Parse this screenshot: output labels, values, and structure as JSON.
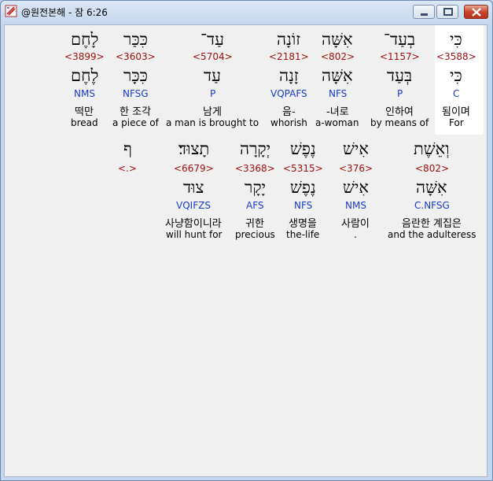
{
  "window": {
    "title": "@원전본해 - 잠 6:26",
    "buttons": {
      "minimize": "minimize-icon",
      "maximize": "maximize-icon",
      "close": "close-icon"
    }
  },
  "colors": {
    "strong": "#a01010",
    "morph": "#1a3cc8",
    "highlight": "#ffffff"
  },
  "row1": [
    {
      "heb": "כִּי",
      "strong": "<3588>",
      "lemma": "כִּי",
      "morph": "C",
      "kor": "됨이며",
      "eng": "For"
    },
    {
      "heb": "בְעַד־",
      "strong": "<1157>",
      "lemma": "בְּעַד",
      "morph": "P",
      "kor": "인하여",
      "eng": "by means of"
    },
    {
      "heb": "אִשָּׁה",
      "strong": "<802>",
      "lemma": "אִשָּׁה",
      "morph": "NFS",
      "kor": "-녀로",
      "eng": "a-woman"
    },
    {
      "heb": "זוֹנָה",
      "strong": "<2181>",
      "lemma": "זָנָה",
      "morph": "VQPAFS",
      "kor": "음-",
      "eng": "whorish"
    },
    {
      "heb": "עַד־",
      "strong": "<5704>",
      "lemma": "עַד",
      "morph": "P",
      "kor": "남게",
      "eng": "a man is brought to"
    },
    {
      "heb": "כִּכַּר",
      "strong": "<3603>",
      "lemma": "כִּכָּר",
      "morph": "NFSG",
      "kor": "한 조각",
      "eng": "a piece of"
    },
    {
      "heb": "לָחֶם",
      "strong": "<3899>",
      "lemma": "לֶחֶם",
      "morph": "NMS",
      "kor": "떡만",
      "eng": "bread"
    }
  ],
  "row2": [
    {
      "heb": "וְאֵשֶׁת",
      "strong": "<802>",
      "lemma": "אִשָּׁה",
      "morph": "C.NFSG",
      "kor": "음란한 계집은",
      "eng": "and the adulteress"
    },
    {
      "heb": "אִישׁ",
      "strong": "<376>",
      "lemma": "אִישׁ",
      "morph": "NMS",
      "kor": "사람이",
      "eng": "."
    },
    {
      "heb": "נֶפֶשׁ",
      "strong": "<5315>",
      "lemma": "נֶפֶשׁ",
      "morph": "NFS",
      "kor": "생명을",
      "eng": "the-life"
    },
    {
      "heb": "יְקָרָה",
      "strong": "<3368>",
      "lemma": "יָקָר",
      "morph": "AFS",
      "kor": "귀한",
      "eng": "precious"
    },
    {
      "heb": "תָצוּד׃",
      "strong": "<6679>",
      "lemma": "צוּד",
      "morph": "VQIFZS",
      "kor": "사냥함이니라",
      "eng": "will hunt for"
    },
    {
      "heb": "ף",
      "strong": "<.>",
      "lemma": "",
      "morph": "",
      "kor": "",
      "eng": ""
    }
  ]
}
